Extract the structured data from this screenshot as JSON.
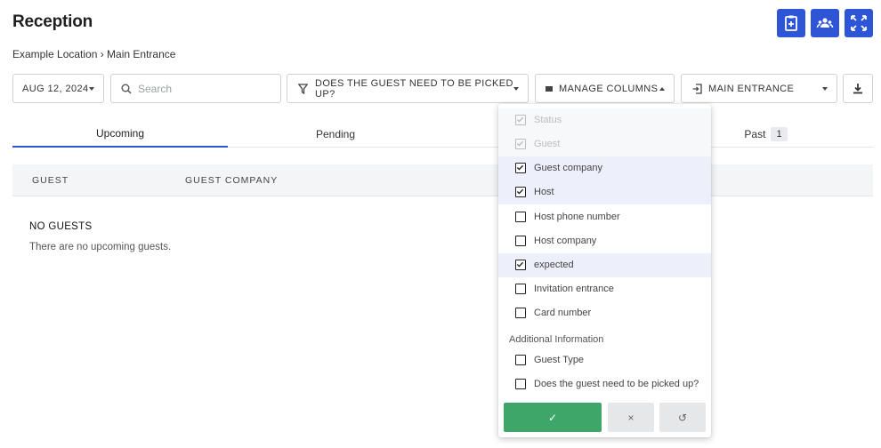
{
  "page": {
    "title": "Reception",
    "breadcrumb": "Example Location › Main Entrance"
  },
  "top_actions": [
    {
      "icon": "clipboard-add-icon"
    },
    {
      "icon": "group-icon"
    },
    {
      "icon": "fullscreen-icon"
    }
  ],
  "toolbar": {
    "date": "AUG 12, 2024",
    "search_placeholder": "Search",
    "filter_label": "DOES THE GUEST NEED TO BE PICKED UP?",
    "manage_columns_label": "MANAGE COLUMNS",
    "entrance_label": "MAIN ENTRANCE"
  },
  "tabs": [
    {
      "label": "Upcoming",
      "active": true
    },
    {
      "label": "Pending"
    },
    {
      "label": "Past",
      "count": "1"
    }
  ],
  "table": {
    "columns": [
      "GUEST",
      "GUEST COMPANY"
    ],
    "empty_title": "NO GUESTS",
    "empty_text": "There are no upcoming guests."
  },
  "columns_menu": {
    "options": [
      {
        "label": "Status",
        "checked": true,
        "disabled": true
      },
      {
        "label": "Guest",
        "checked": true,
        "disabled": true
      },
      {
        "label": "Guest company",
        "checked": true
      },
      {
        "label": "Host",
        "checked": true
      },
      {
        "label": "Host phone number",
        "checked": false
      },
      {
        "label": "Host company",
        "checked": false
      },
      {
        "label": "expected",
        "checked": true
      },
      {
        "label": "Invitation entrance",
        "checked": false
      },
      {
        "label": "Card number",
        "checked": false
      }
    ],
    "additional_label": "Additional Information",
    "additional_options": [
      {
        "label": "Guest Type",
        "checked": false
      },
      {
        "label": "Does the guest need to be picked up?",
        "checked": false
      }
    ],
    "confirm_symbol": "✓",
    "cancel_symbol": "×",
    "reset_symbol": "↺"
  },
  "colors": {
    "primary": "#2d55d6",
    "confirm": "#3fa66a",
    "highlight": "#edf0fb"
  }
}
